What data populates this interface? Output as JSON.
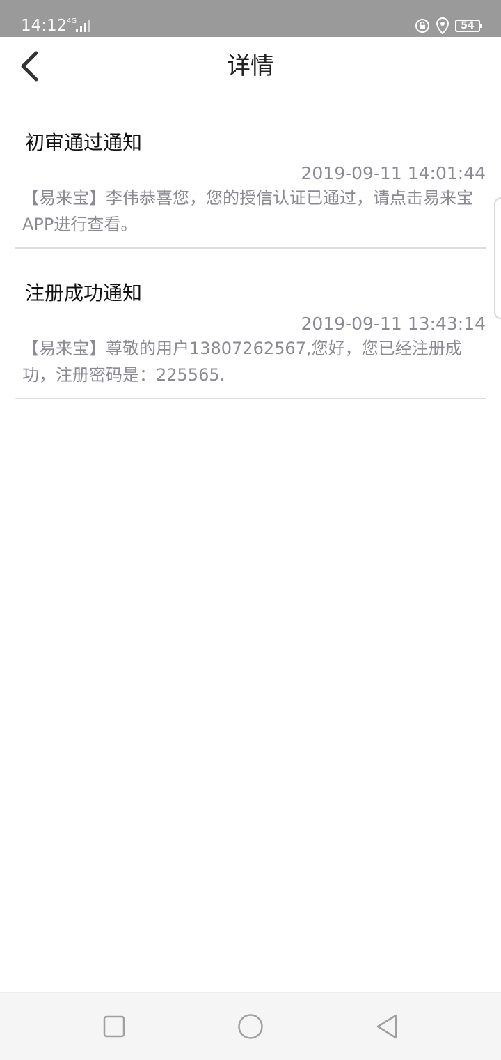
{
  "status_bar": {
    "time": "14:12",
    "network": "4G",
    "battery": "54"
  },
  "header": {
    "title": "详情"
  },
  "notices": [
    {
      "title": "初审通过通知",
      "time": "2019-09-11 14:01:44",
      "body": "【易来宝】李伟恭喜您，您的授信认证已通过，请点击易来宝APP进行查看。"
    },
    {
      "title": "注册成功通知",
      "time": "2019-09-11 13:43:14",
      "body": "【易来宝】尊敬的用户13807262567,您好，您已经注册成功，注册密码是：225565."
    }
  ]
}
